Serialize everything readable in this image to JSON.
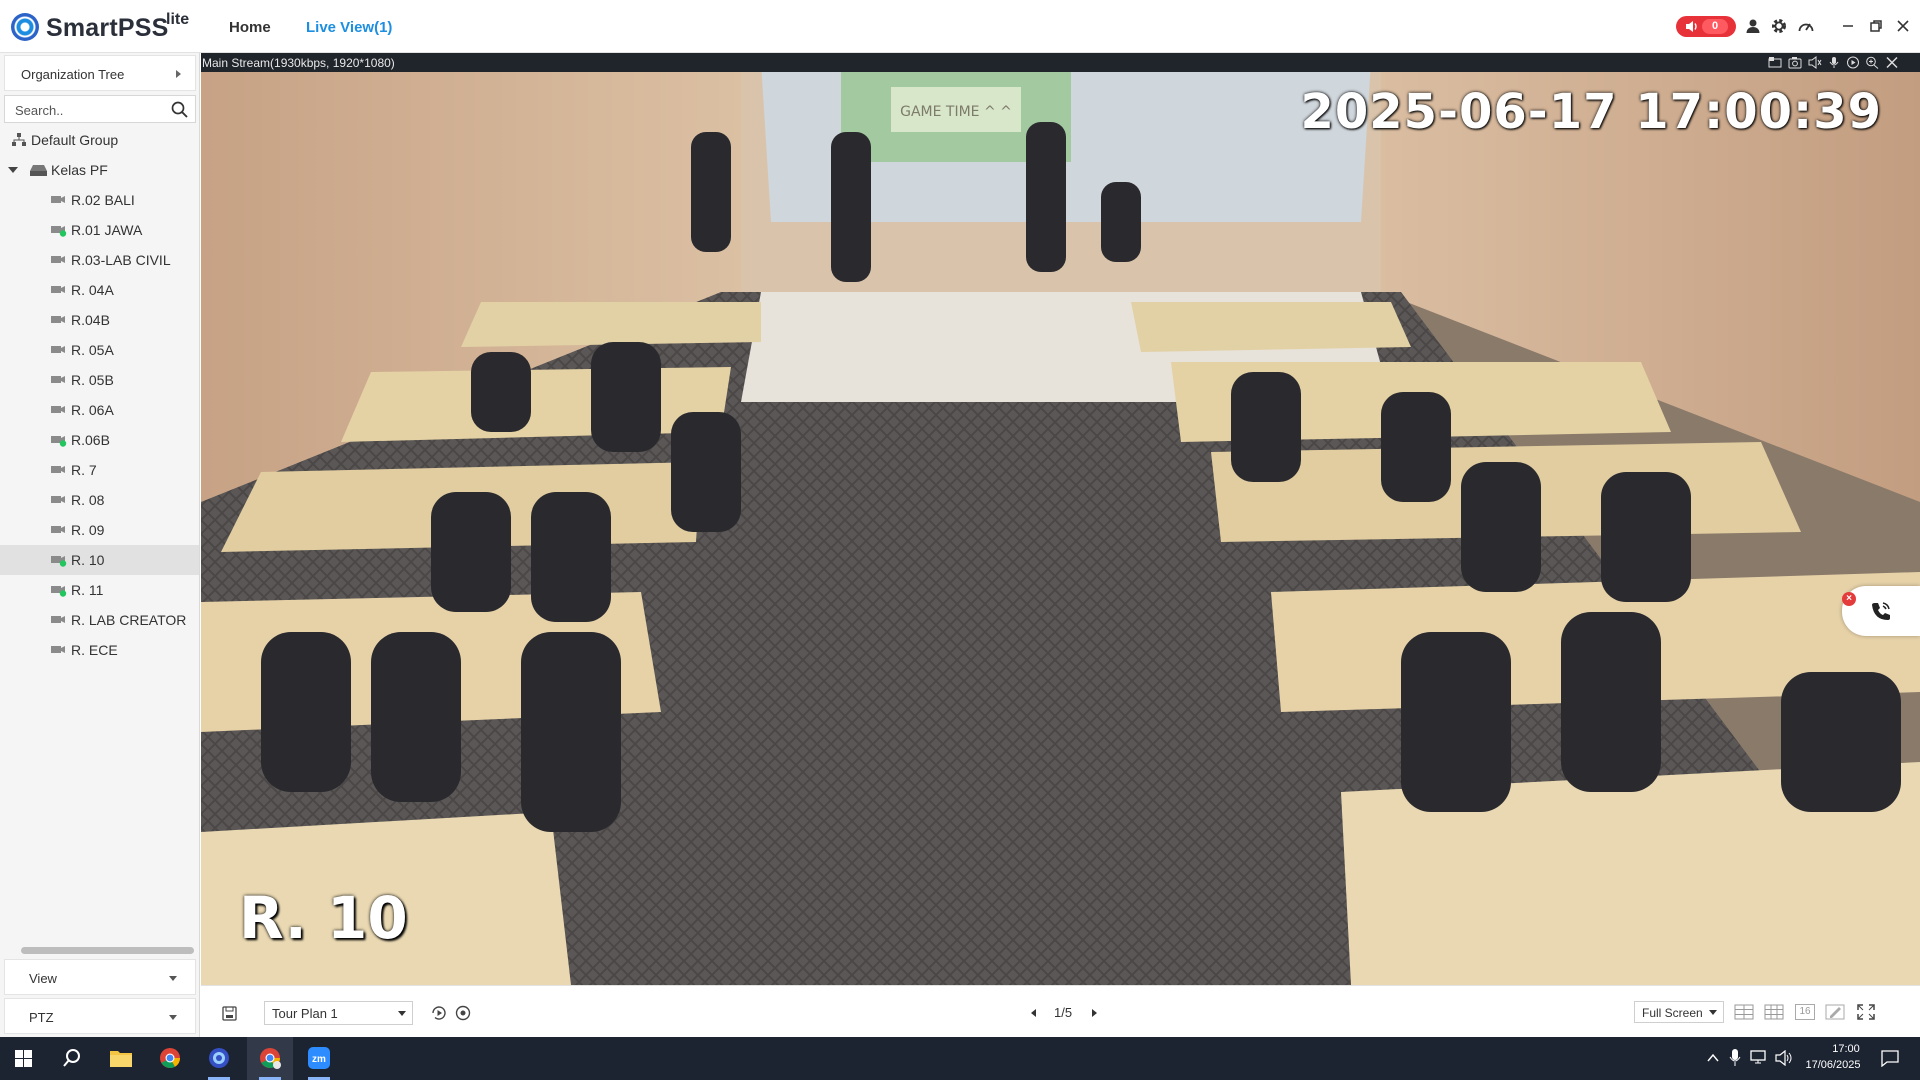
{
  "app": {
    "name": "SmartPSS",
    "edition": "lite"
  },
  "nav": {
    "tabs": [
      {
        "label": "Home"
      },
      {
        "label": "Live View(1)"
      }
    ]
  },
  "alarm": {
    "count": "0"
  },
  "sidebar": {
    "title": "Organization Tree",
    "search": {
      "placeholder": "Search..",
      "value": ""
    },
    "tree": {
      "root": "Default Group",
      "device": "Kelas PF",
      "channels": [
        {
          "label": "R.02 BALI",
          "online": false
        },
        {
          "label": "R.01 JAWA",
          "online": true
        },
        {
          "label": "R.03-LAB CIVIL",
          "online": false
        },
        {
          "label": "R. 04A",
          "online": false
        },
        {
          "label": "R.04B",
          "online": false
        },
        {
          "label": "R. 05A",
          "online": false
        },
        {
          "label": "R. 05B",
          "online": false
        },
        {
          "label": "R. 06A",
          "online": false
        },
        {
          "label": "R.06B",
          "online": true
        },
        {
          "label": "R. 7",
          "online": false
        },
        {
          "label": "R. 08",
          "online": false
        },
        {
          "label": "R. 09",
          "online": false
        },
        {
          "label": "R. 10",
          "online": true,
          "selected": true
        },
        {
          "label": "R. 11",
          "online": true
        },
        {
          "label": "R. LAB CREATOR",
          "online": false
        },
        {
          "label": "R. ECE",
          "online": false
        }
      ]
    },
    "panels": [
      {
        "label": "View"
      },
      {
        "label": "PTZ"
      }
    ]
  },
  "video": {
    "stream_info": "Main Stream(1930kbps, 1920*1080)",
    "osd_time": "2025-06-17 17:00:39",
    "osd_name": "R. 10",
    "whiteboard_text": "GAME TIME ^ ^"
  },
  "toolbar": {
    "tour_plan": "Tour Plan 1",
    "page": "1/5",
    "screen_mode": "Full Screen",
    "layout_16_label": "16"
  },
  "taskbar": {
    "time": "17:00",
    "date": "17/06/2025"
  },
  "colors": {
    "accent": "#1d8fe1",
    "alarm": "#e8323a",
    "online": "#22c55e",
    "taskbar": "#1c2331"
  }
}
